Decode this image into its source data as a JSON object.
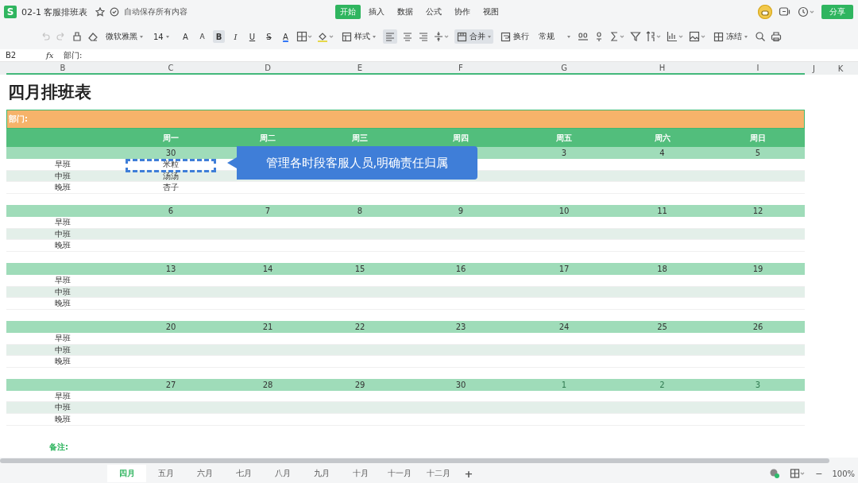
{
  "app": {
    "logo": "S",
    "title": "02-1 客服排班表",
    "autosave": "自动保存所有内容",
    "share": "分享"
  },
  "menu": [
    {
      "label": "开始",
      "selected": true
    },
    {
      "label": "插入",
      "selected": false
    },
    {
      "label": "数据",
      "selected": false
    },
    {
      "label": "公式",
      "selected": false
    },
    {
      "label": "协作",
      "selected": false
    },
    {
      "label": "视图",
      "selected": false
    }
  ],
  "toolbar": {
    "undo_disabled": true,
    "font": "微软雅黑",
    "font_size": "14",
    "grow": "A",
    "shrink": "A",
    "format_buttons": [
      {
        "label": "B",
        "selected": true
      },
      {
        "label": "I",
        "selected": false
      },
      {
        "label": "U",
        "selected": false
      },
      {
        "label": "S",
        "selected": false
      }
    ],
    "font_color": "A",
    "style": "样式",
    "align_left_selected": true,
    "merge": "合并",
    "merge_selected": true,
    "wrap": "换行",
    "number_format": "常规",
    "freeze": "冻结"
  },
  "formula_bar": {
    "cell_ref": "B2",
    "fx": "fx",
    "value": "部门:"
  },
  "columns": [
    "B",
    "C",
    "D",
    "E",
    "F",
    "G",
    "H",
    "I",
    "J",
    "K"
  ],
  "sheet": {
    "title": "四月排班表",
    "department": "部门:",
    "weekdays": [
      "周一",
      "周二",
      "周三",
      "周四",
      "周五",
      "周六",
      "周日"
    ],
    "weeks": [
      {
        "dates": [
          {
            "text": "30",
            "other_month": false
          }
        ],
        "end_dates": [
          {
            "text": "3",
            "other_month": false
          },
          {
            "text": "4",
            "other_month": false
          },
          {
            "text": "5",
            "other_month": false
          }
        ],
        "shifts": [
          {
            "label": "早班",
            "names": [
              "米粒"
            ]
          },
          {
            "label": "中班",
            "names": [
              "汤汤"
            ]
          },
          {
            "label": "晚班",
            "names": [
              "杏子"
            ]
          }
        ]
      },
      {
        "dates": [
          {
            "text": "6",
            "other_month": false
          },
          {
            "text": "7",
            "other_month": false
          },
          {
            "text": "8",
            "other_month": false
          },
          {
            "text": "9",
            "other_month": false
          },
          {
            "text": "10",
            "other_month": false
          },
          {
            "text": "11",
            "other_month": false
          },
          {
            "text": "12",
            "other_month": false
          }
        ],
        "shifts": [
          {
            "label": "早班"
          },
          {
            "label": "中班"
          },
          {
            "label": "晚班"
          }
        ]
      },
      {
        "dates": [
          {
            "text": "13",
            "other_month": false
          },
          {
            "text": "14",
            "other_month": false
          },
          {
            "text": "15",
            "other_month": false
          },
          {
            "text": "16",
            "other_month": false
          },
          {
            "text": "17",
            "other_month": false
          },
          {
            "text": "18",
            "other_month": false
          },
          {
            "text": "19",
            "other_month": false
          }
        ],
        "shifts": [
          {
            "label": "早班"
          },
          {
            "label": "中班"
          },
          {
            "label": "晚班"
          }
        ]
      },
      {
        "dates": [
          {
            "text": "20",
            "other_month": false
          },
          {
            "text": "21",
            "other_month": false
          },
          {
            "text": "22",
            "other_month": false
          },
          {
            "text": "23",
            "other_month": false
          },
          {
            "text": "24",
            "other_month": false
          },
          {
            "text": "25",
            "other_month": false
          },
          {
            "text": "26",
            "other_month": false
          }
        ],
        "shifts": [
          {
            "label": "早班"
          },
          {
            "label": "中班"
          },
          {
            "label": "晚班"
          }
        ]
      },
      {
        "dates": [
          {
            "text": "27",
            "other_month": false
          },
          {
            "text": "28",
            "other_month": false
          },
          {
            "text": "29",
            "other_month": false
          },
          {
            "text": "30",
            "other_month": false
          },
          {
            "text": "1",
            "other_month": true
          },
          {
            "text": "2",
            "other_month": true
          },
          {
            "text": "3",
            "other_month": true
          }
        ],
        "shifts": [
          {
            "label": "早班"
          },
          {
            "label": "中班"
          },
          {
            "label": "晚班"
          }
        ]
      }
    ],
    "remark": "备注:"
  },
  "callout": "管理各时段客服人员,明确责任归属",
  "sheet_tabs": [
    {
      "label": "四月",
      "selected": true
    },
    {
      "label": "五月",
      "selected": false
    },
    {
      "label": "六月",
      "selected": false
    },
    {
      "label": "七月",
      "selected": false
    },
    {
      "label": "八月",
      "selected": false
    },
    {
      "label": "九月",
      "selected": false
    },
    {
      "label": "十月",
      "selected": false
    },
    {
      "label": "十一月",
      "selected": false
    },
    {
      "label": "十二月",
      "selected": false
    }
  ],
  "add_sheet": "+",
  "status": {
    "zoom_out": "−",
    "zoom": "100%"
  }
}
